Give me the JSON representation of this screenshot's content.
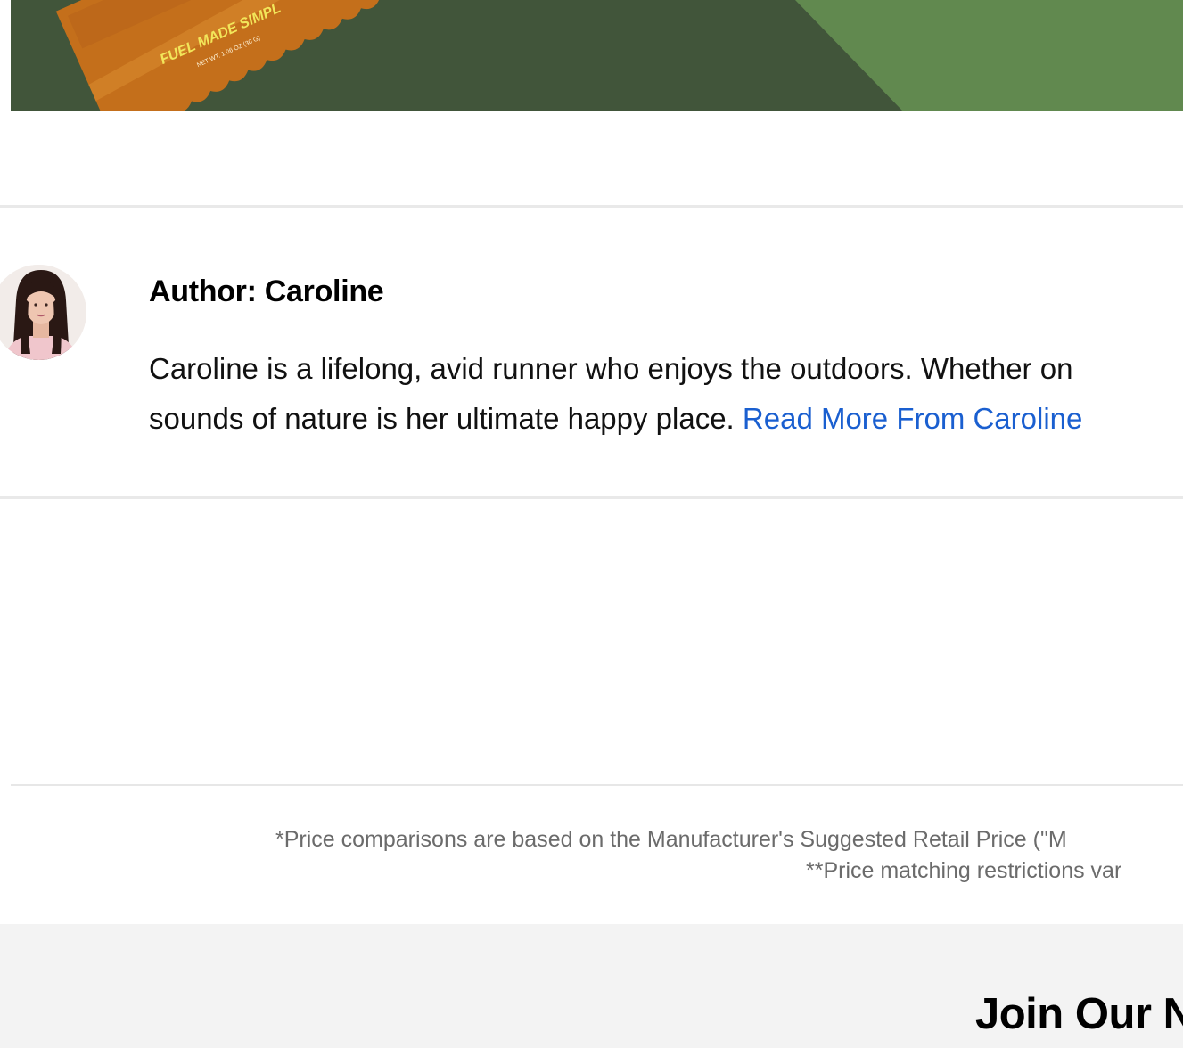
{
  "hero": {
    "package_text_line1": "FUEL MADE SIMPL",
    "package_text_line2": "NET WT. 1.06 OZ (30 G)",
    "colors": {
      "dark_green": "#41553a",
      "light_green": "#61894f",
      "package_orange": "#c46f1b"
    }
  },
  "author": {
    "name_label": "Author: Caroline",
    "bio_line1": "Caroline is a lifelong, avid runner who enjoys the outdoors. Whether on",
    "bio_line2": "sounds of nature is her ultimate happy place.",
    "read_more_link": "Read More From Caroline"
  },
  "disclaimer": {
    "line1": "*Price comparisons are based on the Manufacturer's Suggested Retail Price (\"M",
    "line2": "**Price matching restrictions var"
  },
  "newsletter": {
    "title": "Join Our N"
  },
  "colors": {
    "link": "#1a5fd0",
    "muted_text": "#6b6b6b",
    "footer_bg": "#f3f3f3"
  }
}
